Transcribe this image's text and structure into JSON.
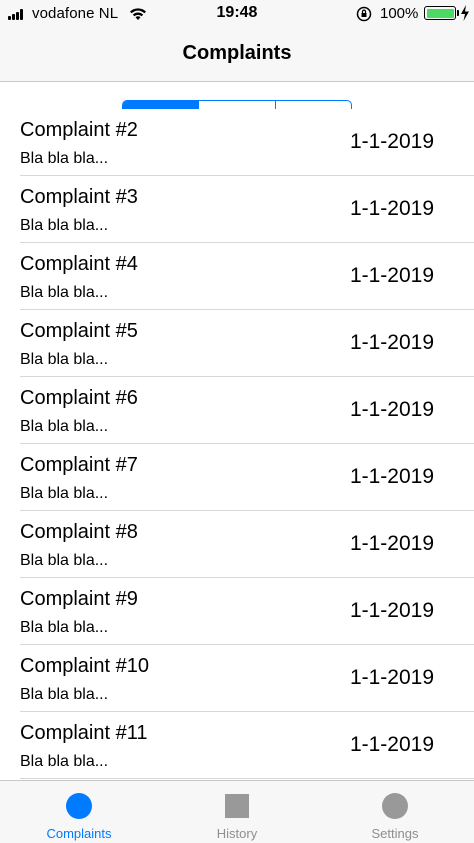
{
  "status_bar": {
    "carrier": "vodafone NL",
    "time": "19:48",
    "battery_percent": "100%",
    "icons": [
      "signal-icon",
      "wifi-icon",
      "rotation-lock-icon",
      "battery-icon",
      "charging-icon"
    ],
    "battery_color": "#4cd964"
  },
  "nav": {
    "title": "Complaints"
  },
  "segmented": {
    "segments": 3,
    "active_index": 0,
    "accent": "#007aff"
  },
  "complaints": [
    {
      "title": "Complaint #2",
      "subtitle": "Bla bla bla...",
      "date": "1-1-2019"
    },
    {
      "title": "Complaint #3",
      "subtitle": "Bla bla bla...",
      "date": "1-1-2019"
    },
    {
      "title": "Complaint #4",
      "subtitle": "Bla bla bla...",
      "date": "1-1-2019"
    },
    {
      "title": "Complaint #5",
      "subtitle": "Bla bla bla...",
      "date": "1-1-2019"
    },
    {
      "title": "Complaint #6",
      "subtitle": "Bla bla bla...",
      "date": "1-1-2019"
    },
    {
      "title": "Complaint #7",
      "subtitle": "Bla bla bla...",
      "date": "1-1-2019"
    },
    {
      "title": "Complaint #8",
      "subtitle": "Bla bla bla...",
      "date": "1-1-2019"
    },
    {
      "title": "Complaint #9",
      "subtitle": "Bla bla bla...",
      "date": "1-1-2019"
    },
    {
      "title": "Complaint #10",
      "subtitle": "Bla bla bla...",
      "date": "1-1-2019"
    },
    {
      "title": "Complaint #11",
      "subtitle": "Bla bla bla...",
      "date": "1-1-2019"
    }
  ],
  "tab_bar": {
    "tabs": [
      {
        "label": "Complaints",
        "icon": "circle-icon",
        "active": true
      },
      {
        "label": "History",
        "icon": "square-icon",
        "active": false
      },
      {
        "label": "Settings",
        "icon": "circle-icon",
        "active": false
      }
    ],
    "active_color": "#007aff",
    "inactive_color": "#8e8e93"
  }
}
